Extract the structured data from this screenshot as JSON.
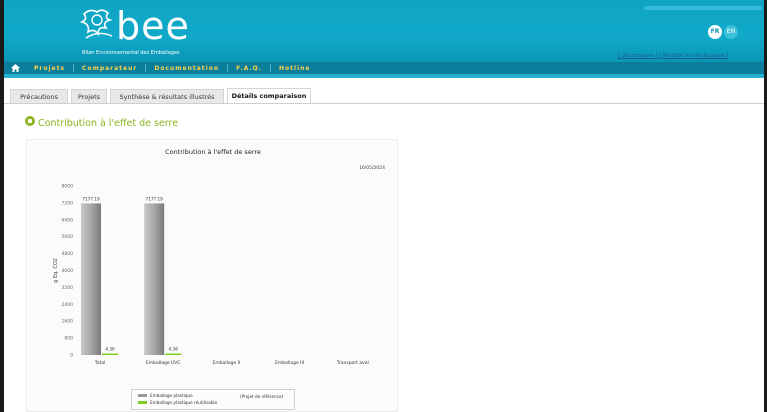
{
  "header": {
    "brand": "bee",
    "brand_subtitle": "Bilan Environnemental des Emballages",
    "languages": [
      "FR",
      "EN"
    ],
    "account_links": [
      "[ Déconnexion ]",
      "[ Modifier le mot de passe ]"
    ]
  },
  "nav": {
    "items": [
      "Projets",
      "Comparateur",
      "Documentation",
      "F.A.Q.",
      "Hotline"
    ]
  },
  "tabs": [
    {
      "label": "Précautions",
      "active": false
    },
    {
      "label": "Projets",
      "active": false
    },
    {
      "label": "Synthèse & résultats illustrés",
      "active": false
    },
    {
      "label": "Détails comparaison",
      "active": true
    }
  ],
  "section": {
    "title": "Contribution à l'effet de serre"
  },
  "chart_data": {
    "type": "bar",
    "title": "Contribution à l'effet de serre",
    "date": "16/05/2024",
    "ylabel": "g Eq. CO2",
    "ylim": [
      0,
      8000
    ],
    "yticks": [
      0,
      800,
      1600,
      2400,
      3200,
      4000,
      4800,
      5600,
      6400,
      7200,
      8000
    ],
    "categories": [
      "Total",
      "Emballage UVC",
      "Emballage II",
      "Emballage III",
      "Transport aval"
    ],
    "series": [
      {
        "name": "Emballage plastique",
        "color": "#9a9a9a",
        "values": [
          7177.19,
          7177.19,
          null,
          null,
          null
        ],
        "labels": [
          "7177.19",
          "7177.19",
          "",
          "",
          ""
        ]
      },
      {
        "name": "Emballage plastique réutilisable",
        "color": "#7fcf1e",
        "values": [
          4.36,
          4.36,
          null,
          null,
          null
        ],
        "labels": [
          "4.36",
          "4.36",
          "",
          "",
          ""
        ]
      }
    ],
    "legend": {
      "placement": "bottom",
      "reference_note": "(Projet de référence)"
    },
    "grid": false
  }
}
